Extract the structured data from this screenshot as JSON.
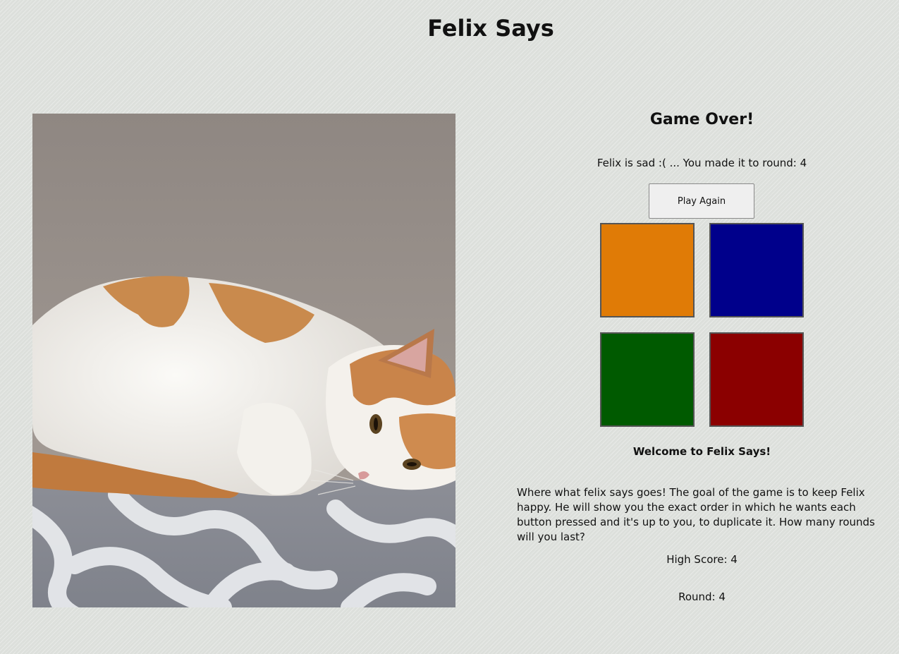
{
  "page": {
    "title": "Felix Says"
  },
  "game": {
    "status_heading": "Game Over!",
    "status_message": "Felix is sad :( ... You made it to round: 4",
    "play_again_label": "Play Again",
    "pads": [
      {
        "name": "orange-pad",
        "color": "#e07b06"
      },
      {
        "name": "blue-pad",
        "color": "#00008b"
      },
      {
        "name": "green-pad",
        "color": "#005a00"
      },
      {
        "name": "red-pad",
        "color": "#8b0000"
      }
    ]
  },
  "info": {
    "welcome": "Welcome to Felix Says!",
    "description": "Where what felix says goes! The goal of the game is to keep Felix happy. He will show you the exact order in which he wants each button pressed and it's up to you, to duplicate it. How many rounds will you last?",
    "high_score": "High Score: 4",
    "round": "Round: 4"
  }
}
